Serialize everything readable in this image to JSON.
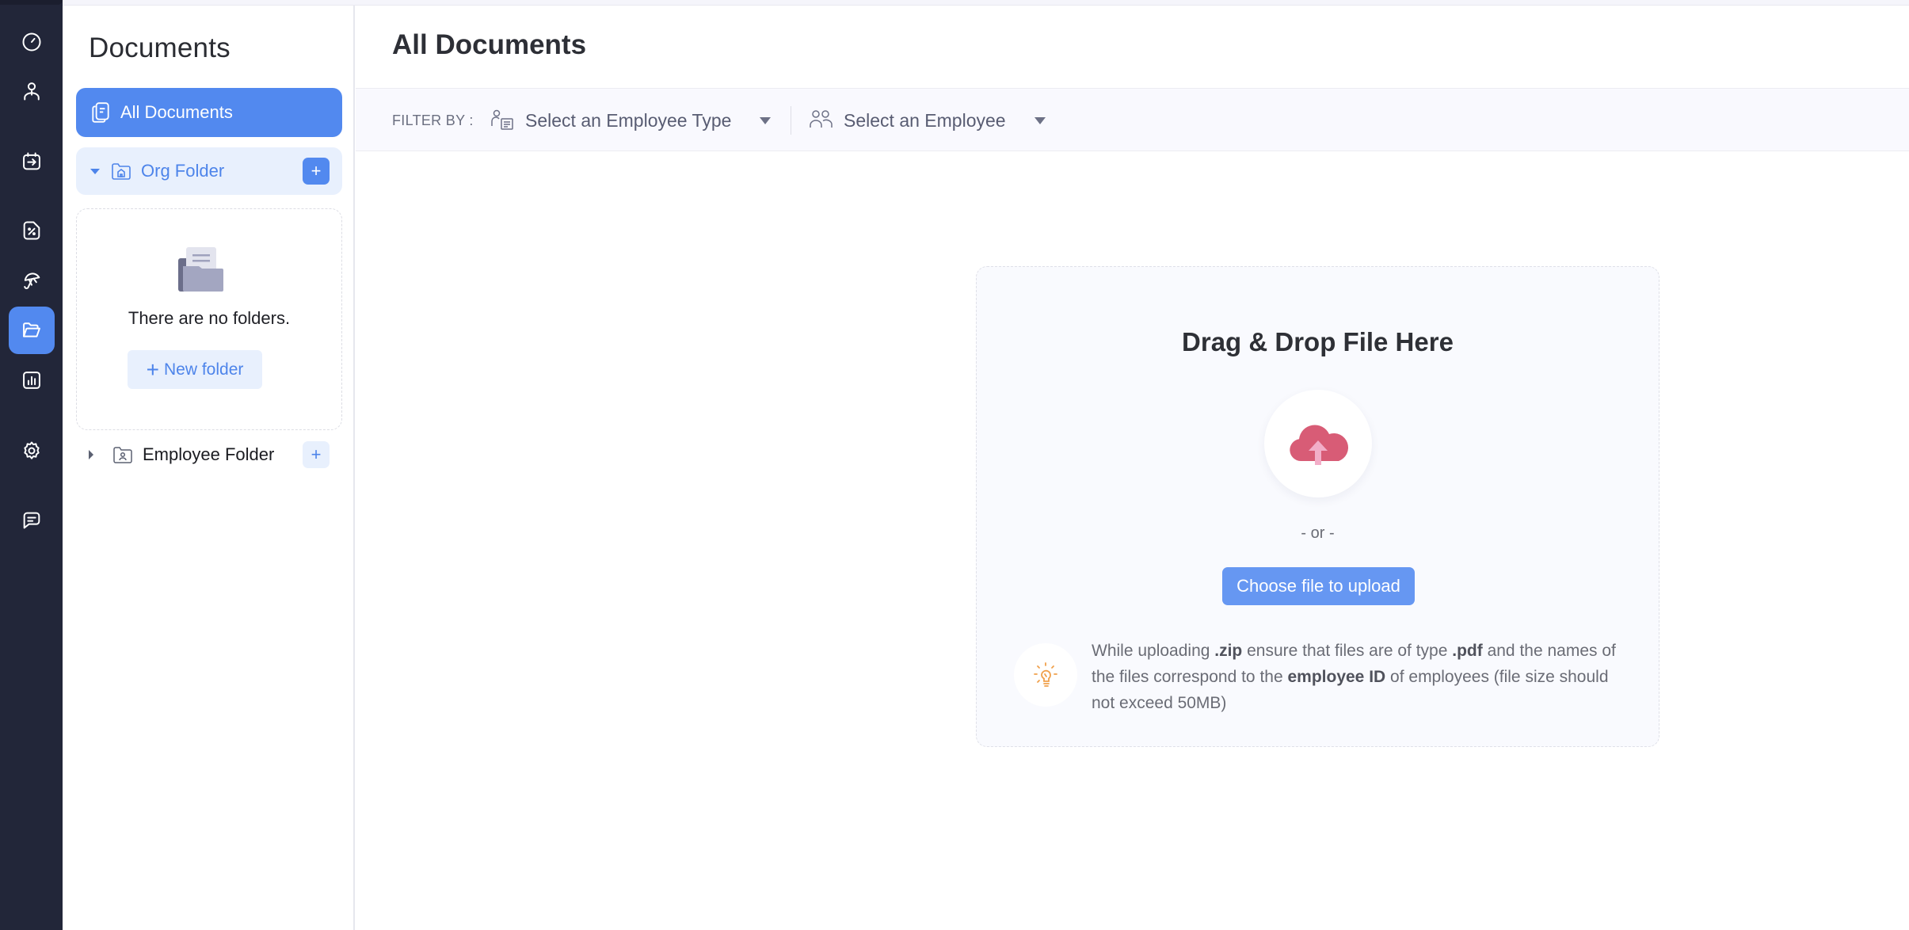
{
  "rail": {
    "items": [
      {
        "icon": "dashboard-gauge-icon",
        "active": false
      },
      {
        "icon": "user-icon",
        "active": false
      },
      {
        "icon": "calendar-checkin-icon",
        "active": false
      },
      {
        "icon": "percent-document-icon",
        "active": false
      },
      {
        "icon": "umbrella-leave-icon",
        "active": false
      },
      {
        "icon": "folder-open-icon",
        "active": true
      },
      {
        "icon": "bar-chart-icon",
        "active": false
      },
      {
        "icon": "gear-icon",
        "active": false
      },
      {
        "icon": "chat-icon",
        "active": false
      }
    ]
  },
  "panel": {
    "title": "Documents",
    "all_documents_label": "All Documents",
    "org_folder_label": "Org Folder",
    "org_folder_add": "+",
    "empty_text": "There are no folders.",
    "new_folder_plus": "+",
    "new_folder_label": "New folder",
    "employee_folder_label": "Employee Folder",
    "employee_folder_add": "+"
  },
  "main": {
    "title": "All Documents",
    "filter_label": "FILTER BY :",
    "employee_type_placeholder": "Select an Employee Type",
    "employee_placeholder": "Select an Employee"
  },
  "upload": {
    "title": "Drag & Drop File Here",
    "or_text": "- or -",
    "choose_button": "Choose file to upload",
    "hint_parts": [
      {
        "text": "While uploading ",
        "bold": false
      },
      {
        "text": ".zip",
        "bold": true
      },
      {
        "text": " ensure that files are of type ",
        "bold": false
      },
      {
        "text": ".pdf",
        "bold": true
      },
      {
        "text": " and the names of the files correspond to the ",
        "bold": false
      },
      {
        "text": "employee ID",
        "bold": true
      },
      {
        "text": " of employees (file size should not exceed 50MB)",
        "bold": false
      }
    ]
  },
  "colors": {
    "rail_bg": "#222639",
    "accent": "#5289ef",
    "accent_light": "#e8f0fd",
    "cloud": "#D85C76",
    "cloud_arrow": "#F2AEC8",
    "hint_bulb": "#f0a04b"
  }
}
